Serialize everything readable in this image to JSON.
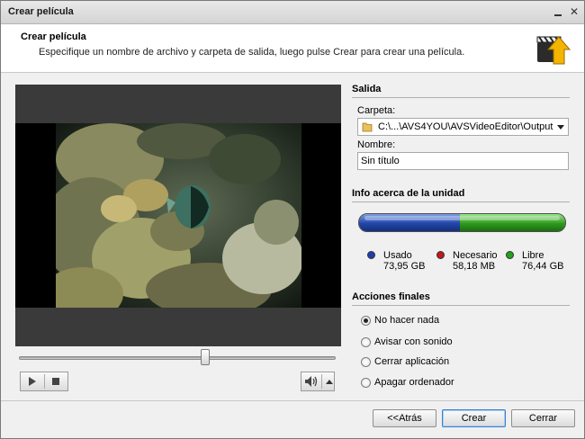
{
  "window": {
    "title": "Crear película"
  },
  "header": {
    "title": "Crear película",
    "description": "Especifique un nombre de archivo y carpeta de salida, luego pulse Crear para crear una película."
  },
  "output": {
    "section_title": "Salida",
    "folder_label": "Carpeta:",
    "folder_value": "C:\\...\\AVS4YOU\\AVSVideoEditor\\Output",
    "name_label": "Nombre:",
    "name_value": "Sin título"
  },
  "disk_info": {
    "section_title": "Info acerca de la unidad",
    "used_fraction": 0.49,
    "free_fraction": 0.51,
    "legend": [
      {
        "name": "Usado",
        "value": "73,95 GB",
        "color": "#1d3fae"
      },
      {
        "name": "Necesario",
        "value": "58,18 MB",
        "color": "#c41818"
      },
      {
        "name": "Libre",
        "value": "76,44 GB",
        "color": "#22a31a"
      }
    ]
  },
  "final_actions": {
    "section_title": "Acciones finales",
    "options": [
      {
        "label": "No hacer nada",
        "checked": true
      },
      {
        "label": "Avisar con sonido",
        "checked": false
      },
      {
        "label": "Cerrar aplicación",
        "checked": false
      },
      {
        "label": "Apagar ordenador",
        "checked": false
      }
    ]
  },
  "player": {
    "seek_position_fraction": 0.59
  },
  "buttons": {
    "back": "<<Atrás",
    "create": "Crear",
    "close": "Cerrar"
  }
}
